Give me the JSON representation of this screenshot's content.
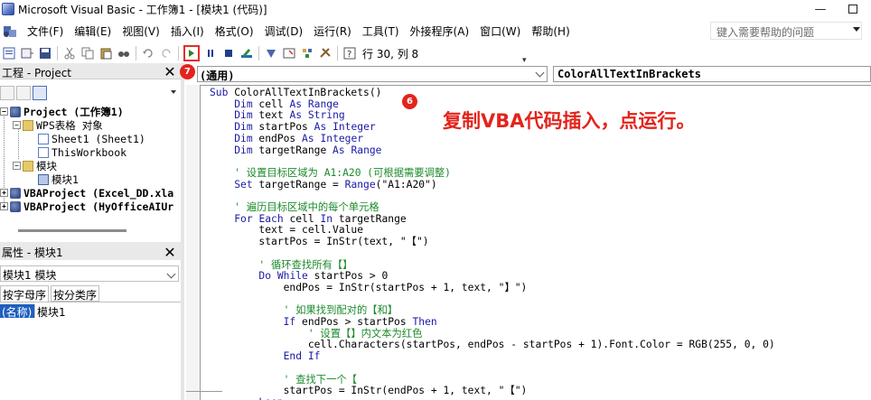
{
  "window": {
    "title": "Microsoft Visual Basic - 工作簿1 - [模块1 (代码)]",
    "minimize": "—"
  },
  "menu": {
    "items": [
      "文件(F)",
      "编辑(E)",
      "视图(V)",
      "插入(I)",
      "格式(O)",
      "调试(D)",
      "运行(R)",
      "工具(T)",
      "外接程序(A)",
      "窗口(W)",
      "帮助(H)"
    ],
    "help_placeholder": "键入需要帮助的问题"
  },
  "toolbar": {
    "position": "行 30, 列 8"
  },
  "project": {
    "header": "工程 - Project",
    "tree": [
      {
        "label": "Project (工作簿1)",
        "bold": true
      },
      {
        "label": "WPS表格 对象",
        "bold": false
      },
      {
        "label": "Sheet1 (Sheet1)",
        "bold": false
      },
      {
        "label": "ThisWorkbook",
        "bold": false
      },
      {
        "label": "模块",
        "bold": false
      },
      {
        "label": "模块1",
        "bold": false
      },
      {
        "label": "VBAProject (Excel_DD.xla",
        "bold": true
      },
      {
        "label": "VBAProject (HyOfficeAIUr",
        "bold": true
      }
    ]
  },
  "properties": {
    "header": "属性 - 模块1",
    "object_select": "模块1 模块",
    "tabs": [
      "按字母序",
      "按分类序"
    ],
    "row_key": "(名称)",
    "row_value": "模块1"
  },
  "code": {
    "object_combo": "(通用)",
    "proc_combo": "ColorAllTextInBrackets",
    "lines": [
      {
        "t": "Sub ColorAllTextInBrackets()",
        "k": "code"
      },
      {
        "t": "    Dim cell As Range",
        "k": "code"
      },
      {
        "t": "    Dim text As String",
        "k": "code"
      },
      {
        "t": "    Dim startPos As Integer",
        "k": "code"
      },
      {
        "t": "    Dim endPos As Integer",
        "k": "code"
      },
      {
        "t": "    Dim targetRange As Range",
        "k": "code"
      },
      {
        "t": "",
        "k": "code"
      },
      {
        "t": "    ' 设置目标区域为 A1:A20 (可根据需要调整)",
        "k": "comment"
      },
      {
        "t": "    Set targetRange = Range(\"A1:A20\")",
        "k": "code"
      },
      {
        "t": "",
        "k": "code"
      },
      {
        "t": "    ' 遍历目标区域中的每个单元格",
        "k": "comment"
      },
      {
        "t": "    For Each cell In targetRange",
        "k": "code"
      },
      {
        "t": "        text = cell.Value",
        "k": "code"
      },
      {
        "t": "        startPos = InStr(text, \"【\")",
        "k": "code"
      },
      {
        "t": "",
        "k": "code"
      },
      {
        "t": "        ' 循环查找所有【】",
        "k": "comment"
      },
      {
        "t": "        Do While startPos > 0",
        "k": "code"
      },
      {
        "t": "            endPos = InStr(startPos + 1, text, \"】\")",
        "k": "code"
      },
      {
        "t": "",
        "k": "code"
      },
      {
        "t": "            ' 如果找到配对的【和】",
        "k": "comment"
      },
      {
        "t": "            If endPos > startPos Then",
        "k": "code"
      },
      {
        "t": "                ' 设置【】内文本为红色",
        "k": "comment"
      },
      {
        "t": "                cell.Characters(startPos, endPos - startPos + 1).Font.Color = RGB(255, 0, 0)",
        "k": "code"
      },
      {
        "t": "            End If",
        "k": "code"
      },
      {
        "t": "",
        "k": "code"
      },
      {
        "t": "            ' 查找下一个【",
        "k": "comment"
      },
      {
        "t": "            startPos = InStr(endPos + 1, text, \"【\")",
        "k": "code"
      },
      {
        "t": "        Loop",
        "k": "code"
      }
    ]
  },
  "annotations": {
    "step6": "6",
    "step7": "7",
    "instruction": "复制VBA代码插入，点运行。",
    "color": "#e3241c"
  }
}
